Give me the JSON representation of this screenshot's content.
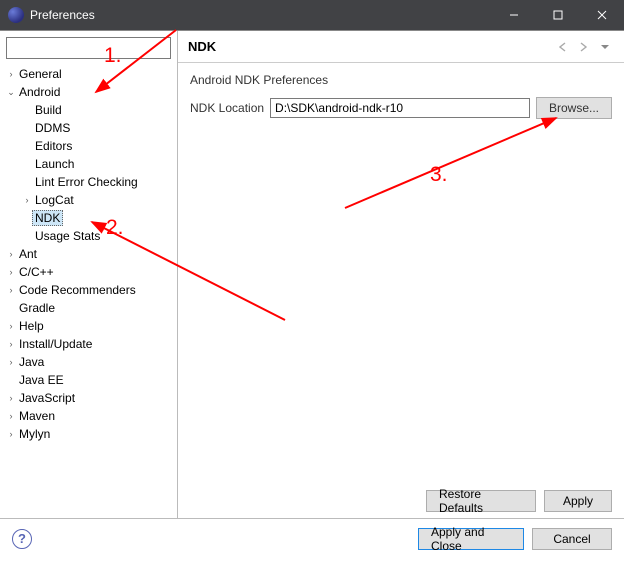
{
  "window": {
    "title": "Preferences"
  },
  "tree": {
    "items": [
      {
        "label": "General",
        "indent": 0,
        "expander": "›",
        "selected": false
      },
      {
        "label": "Android",
        "indent": 0,
        "expander": "⌄",
        "selected": false
      },
      {
        "label": "Build",
        "indent": 1,
        "expander": "",
        "selected": false
      },
      {
        "label": "DDMS",
        "indent": 1,
        "expander": "",
        "selected": false
      },
      {
        "label": "Editors",
        "indent": 1,
        "expander": "",
        "selected": false
      },
      {
        "label": "Launch",
        "indent": 1,
        "expander": "",
        "selected": false
      },
      {
        "label": "Lint Error Checking",
        "indent": 1,
        "expander": "",
        "selected": false
      },
      {
        "label": "LogCat",
        "indent": 1,
        "expander": "›",
        "selected": false
      },
      {
        "label": "NDK",
        "indent": 1,
        "expander": "",
        "selected": true
      },
      {
        "label": "Usage Stats",
        "indent": 1,
        "expander": "",
        "selected": false
      },
      {
        "label": "Ant",
        "indent": 0,
        "expander": "›",
        "selected": false
      },
      {
        "label": "C/C++",
        "indent": 0,
        "expander": "›",
        "selected": false
      },
      {
        "label": "Code Recommenders",
        "indent": 0,
        "expander": "›",
        "selected": false
      },
      {
        "label": "Gradle",
        "indent": 0,
        "expander": "",
        "selected": false
      },
      {
        "label": "Help",
        "indent": 0,
        "expander": "›",
        "selected": false
      },
      {
        "label": "Install/Update",
        "indent": 0,
        "expander": "›",
        "selected": false
      },
      {
        "label": "Java",
        "indent": 0,
        "expander": "›",
        "selected": false
      },
      {
        "label": "Java EE",
        "indent": 0,
        "expander": "",
        "selected": false
      },
      {
        "label": "JavaScript",
        "indent": 0,
        "expander": "›",
        "selected": false
      },
      {
        "label": "Maven",
        "indent": 0,
        "expander": "›",
        "selected": false
      },
      {
        "label": "Mylyn",
        "indent": 0,
        "expander": "›",
        "selected": false
      }
    ]
  },
  "page": {
    "heading": "NDK",
    "subtitle": "Android NDK Preferences",
    "field_label": "NDK Location",
    "field_value": "D:\\SDK\\android-ndk-r10",
    "browse_label": "Browse...",
    "restore_label": "Restore Defaults",
    "apply_label": "Apply"
  },
  "footer": {
    "apply_close_label": "Apply and Close",
    "cancel_label": "Cancel"
  },
  "annotations": {
    "n1": "1.",
    "n2": "2.",
    "n3": "3."
  }
}
